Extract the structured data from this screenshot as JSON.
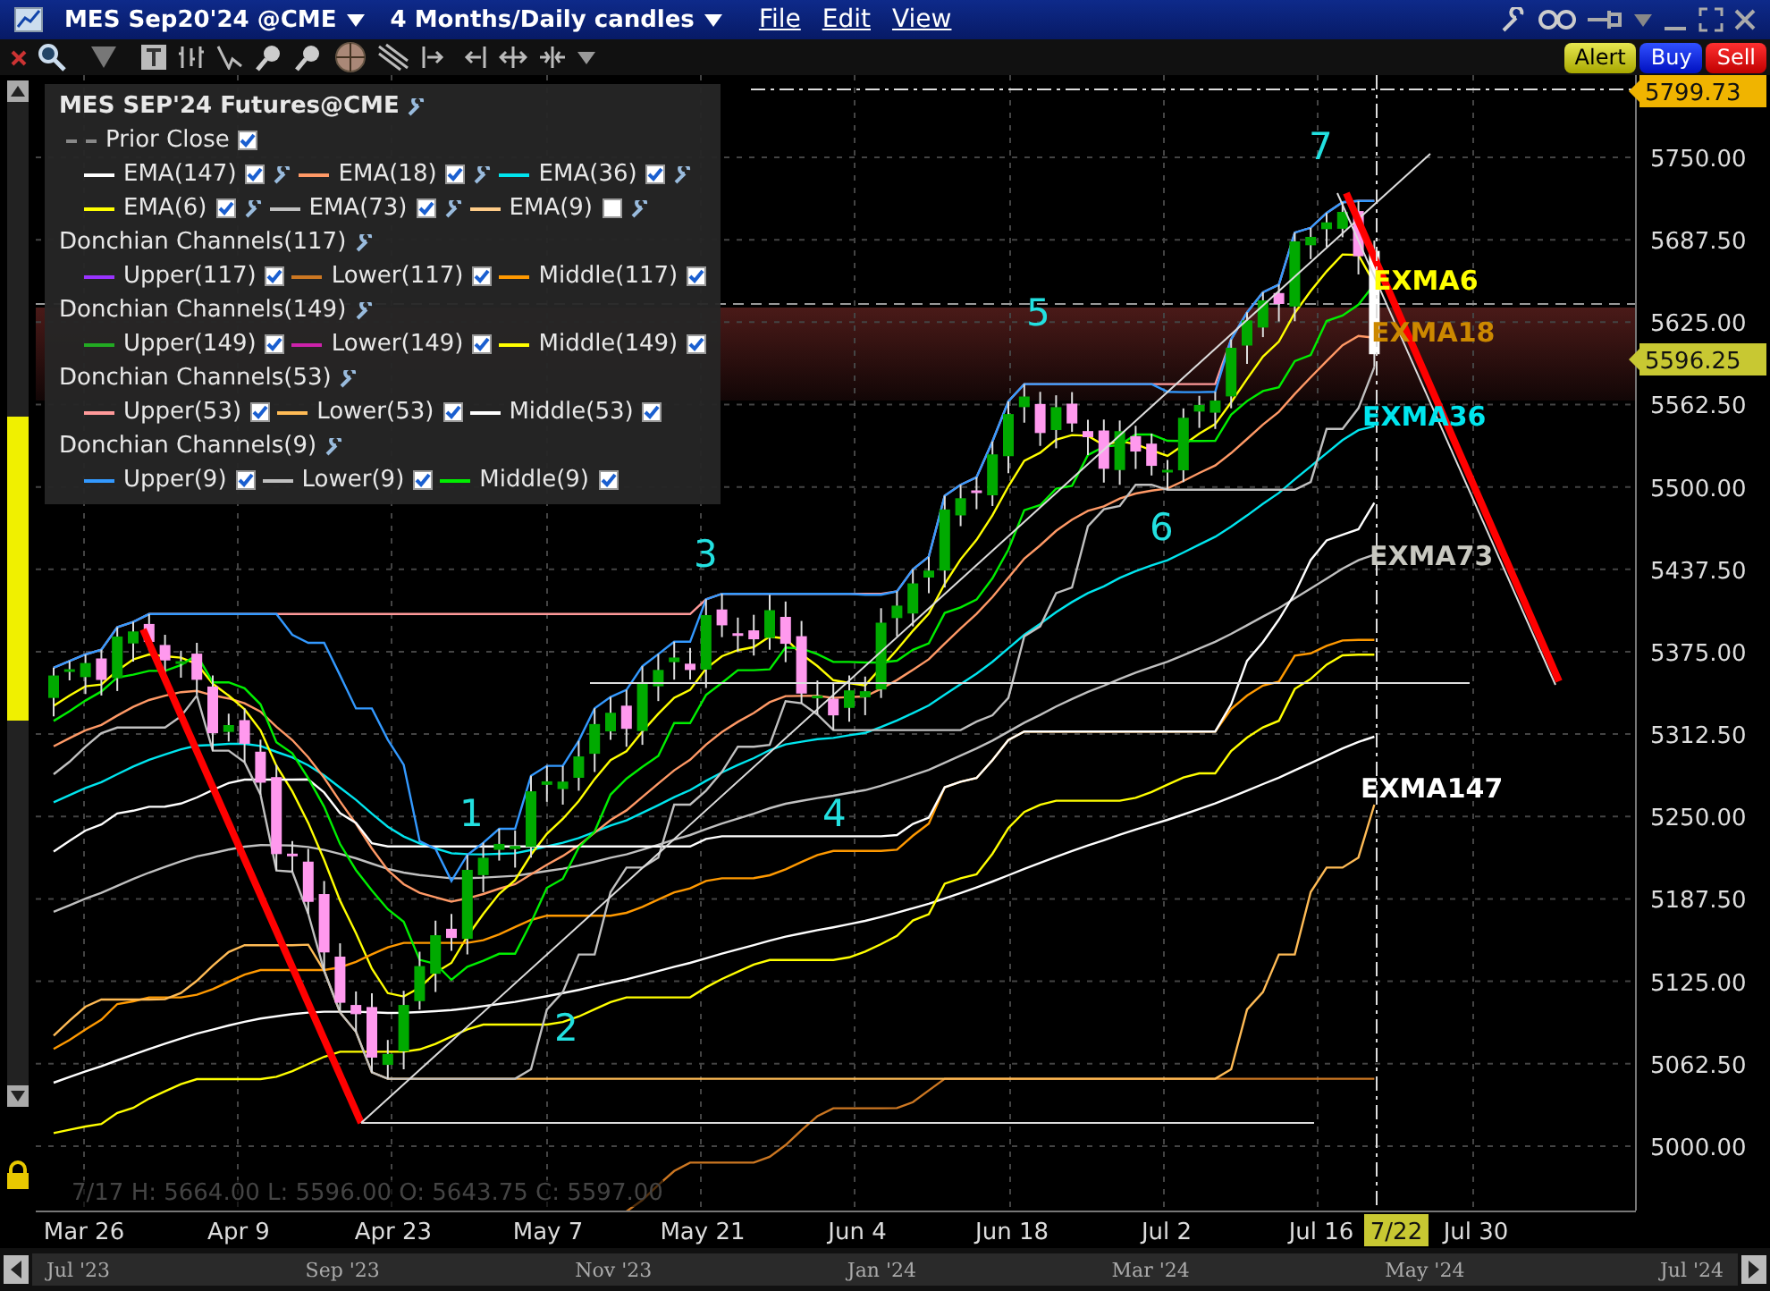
{
  "title_bar": {
    "symbol": "MES Sep20'24 @CME",
    "period": "4 Months/Daily candles",
    "menu": [
      "File",
      "Edit",
      "View"
    ]
  },
  "trade_buttons": [
    {
      "label": "Alert",
      "kind": "alert"
    },
    {
      "label": "Buy",
      "kind": "buy"
    },
    {
      "label": "Sell",
      "kind": "sell"
    }
  ],
  "legend": {
    "title": "MES SEP'24 Futures@CME",
    "rows": [
      {
        "kind": "items",
        "items": [
          {
            "label": "Prior Close",
            "color": "#888888",
            "kind": "dashed",
            "checked": true,
            "settings_icon": false
          }
        ]
      },
      {
        "kind": "items",
        "items": [
          {
            "label": "EMA(147)",
            "color": "#ffffff",
            "kind": "solid",
            "checked": true,
            "settings_icon": true
          },
          {
            "label": "EMA(18)",
            "color": "#ff9966",
            "kind": "solid",
            "checked": true,
            "settings_icon": true
          },
          {
            "label": "EMA(36)",
            "color": "#00e5ee",
            "kind": "solid",
            "checked": true,
            "settings_icon": true
          }
        ]
      },
      {
        "kind": "items",
        "items": [
          {
            "label": "EMA(6)",
            "color": "#ffff00",
            "kind": "solid",
            "checked": true,
            "settings_icon": true
          },
          {
            "label": "EMA(73)",
            "color": "#c0c0c0",
            "kind": "solid",
            "checked": true,
            "settings_icon": true
          },
          {
            "label": "EMA(9)",
            "color": "#ffcc88",
            "kind": "solid",
            "checked": false,
            "settings_icon": true
          }
        ]
      },
      {
        "kind": "header",
        "label": "Donchian Channels(117)"
      },
      {
        "kind": "items",
        "items": [
          {
            "label": "Upper(117)",
            "color": "#9933ff",
            "kind": "solid",
            "checked": true,
            "settings_icon": false
          },
          {
            "label": "Lower(117)",
            "color": "#cc7722",
            "kind": "solid",
            "checked": true,
            "settings_icon": false
          },
          {
            "label": "Middle(117)",
            "color": "#ff9900",
            "kind": "solid",
            "checked": true,
            "settings_icon": false
          }
        ]
      },
      {
        "kind": "header",
        "label": "Donchian Channels(149)"
      },
      {
        "kind": "items",
        "items": [
          {
            "label": "Upper(149)",
            "color": "#22aa22",
            "kind": "solid",
            "checked": true,
            "settings_icon": false
          },
          {
            "label": "Lower(149)",
            "color": "#cc22aa",
            "kind": "solid",
            "checked": true,
            "settings_icon": false
          },
          {
            "label": "Middle(149)",
            "color": "#ffff00",
            "kind": "solid",
            "checked": true,
            "settings_icon": false
          }
        ]
      },
      {
        "kind": "header",
        "label": "Donchian Channels(53)"
      },
      {
        "kind": "items",
        "items": [
          {
            "label": "Upper(53)",
            "color": "#ff9999",
            "kind": "solid",
            "checked": true,
            "settings_icon": false
          },
          {
            "label": "Lower(53)",
            "color": "#ffbb55",
            "kind": "solid",
            "checked": true,
            "settings_icon": false
          },
          {
            "label": "Middle(53)",
            "color": "#ffffff",
            "kind": "solid",
            "checked": true,
            "settings_icon": false
          }
        ]
      },
      {
        "kind": "header",
        "label": "Donchian Channels(9)"
      },
      {
        "kind": "items",
        "items": [
          {
            "label": "Upper(9)",
            "color": "#3399ff",
            "kind": "solid",
            "checked": true,
            "settings_icon": false
          },
          {
            "label": "Lower(9)",
            "color": "#c0c0c0",
            "kind": "solid",
            "checked": true,
            "settings_icon": false
          },
          {
            "label": "Middle(9)",
            "color": "#00ee00",
            "kind": "solid",
            "checked": true,
            "settings_icon": false
          }
        ]
      }
    ]
  },
  "chart": {
    "wave_labels": [
      "1",
      "2",
      "3",
      "4",
      "5",
      "6",
      "7"
    ],
    "ema_labels": [
      {
        "text": "EXMA6",
        "color": "#ffff00"
      },
      {
        "text": "EXMA18",
        "color": "#cc8800"
      },
      {
        "text": "EXMA36",
        "color": "#00e5ee"
      },
      {
        "text": "EXMA73",
        "color": "#c8c8c0"
      },
      {
        "text": "EXMA147",
        "color": "#ffffff"
      }
    ],
    "price_labels": [
      "5750.00",
      "5687.50",
      "5625.00",
      "5562.50",
      "5500.00",
      "5437.50",
      "5375.00",
      "5312.50",
      "5250.00",
      "5187.50",
      "5125.00",
      "5062.50",
      "5000.00"
    ],
    "price_badges": [
      {
        "text": "5799.73",
        "kind": "high"
      },
      {
        "text": "5596.25",
        "kind": "last"
      }
    ],
    "status": "7/17 H: 5664.00 L: 5596.00 O: 5643.75 C: 5597.00"
  },
  "date_axis": {
    "labels": [
      "Mar 26",
      "Apr 9",
      "Apr 23",
      "May 7",
      "May 21",
      "Jun 4",
      "Jun 18",
      "Jul 2",
      "Jul 16",
      "Jul 30"
    ],
    "cursor": "7/22"
  },
  "scroller": {
    "labels": [
      "Jul '23",
      "Sep '23",
      "Nov '23",
      "Jan '24",
      "Mar '24",
      "May '24",
      "Jul '24"
    ]
  }
}
